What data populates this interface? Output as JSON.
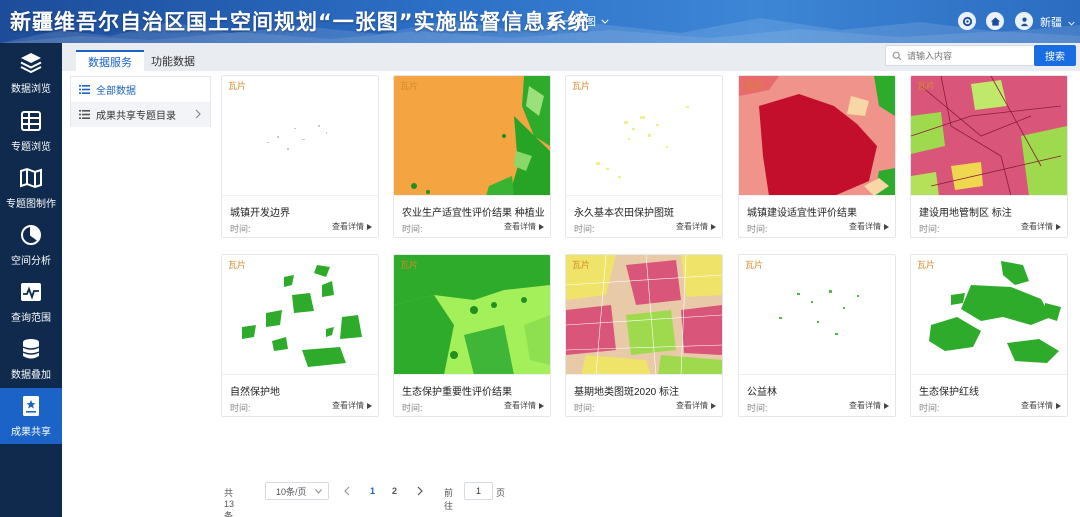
{
  "header": {
    "title": "新疆维吾尔自治区国土空间规划“一张图”实施监督信息系统",
    "scope": "一张图",
    "region": "新疆"
  },
  "sidebar": {
    "items": [
      {
        "label": "数据浏览",
        "icon": "layers-icon"
      },
      {
        "label": "专题浏览",
        "icon": "table-icon"
      },
      {
        "label": "专题图制作",
        "icon": "map-icon"
      },
      {
        "label": "空间分析",
        "icon": "pie-icon"
      },
      {
        "label": "查询范围",
        "icon": "chart-icon"
      },
      {
        "label": "数据叠加",
        "icon": "database-icon"
      },
      {
        "label": "成果共享",
        "icon": "share-icon",
        "active": true
      }
    ]
  },
  "tabs": [
    {
      "label": "数据服务",
      "active": true
    },
    {
      "label": "功能数据",
      "active": false
    }
  ],
  "search": {
    "placeholder": "请输入内容",
    "button": "搜索"
  },
  "categories": {
    "all": "全部数据",
    "share": "成果共享专题目录"
  },
  "cards": [
    {
      "tag": "瓦片",
      "name": "城镇开发边界",
      "time": "时间:",
      "more": "查看详情"
    },
    {
      "tag": "瓦片",
      "name": "农业生产适宜性评价结果 种植业",
      "time": "时间:",
      "more": "查看详情"
    },
    {
      "tag": "瓦片",
      "name": "永久基本农田保护图斑",
      "time": "时间:",
      "more": "查看详情"
    },
    {
      "tag": "瓦片",
      "name": "城镇建设适宜性评价结果",
      "time": "时间:",
      "more": "查看详情"
    },
    {
      "tag": "瓦片",
      "name": "建设用地管制区 标注",
      "time": "时间:",
      "more": "查看详情"
    },
    {
      "tag": "瓦片",
      "name": "自然保护地",
      "time": "时间:",
      "more": "查看详情"
    },
    {
      "tag": "瓦片",
      "name": "生态保护重要性评价结果",
      "time": "时间:",
      "more": "查看详情"
    },
    {
      "tag": "瓦片",
      "name": "基期地类图斑2020 标注",
      "time": "时间:",
      "more": "查看详情"
    },
    {
      "tag": "瓦片",
      "name": "公益林",
      "time": "时间:",
      "more": "查看详情"
    },
    {
      "tag": "瓦片",
      "name": "生态保护红线",
      "time": "时间:",
      "more": "查看详情"
    }
  ],
  "pagination": {
    "total": "共 13 条",
    "page_size": "10条/页",
    "pages": [
      "1",
      "2"
    ],
    "current": "1",
    "goto_label": "前往",
    "goto_value": "1",
    "page_suffix": "页"
  },
  "colors": {
    "header": "#2c6fc6",
    "sidebar": "#0f2a4d",
    "sidebar_active": "#1c63c7",
    "accent": "#1a63c6",
    "tag": "#d18b2b"
  }
}
